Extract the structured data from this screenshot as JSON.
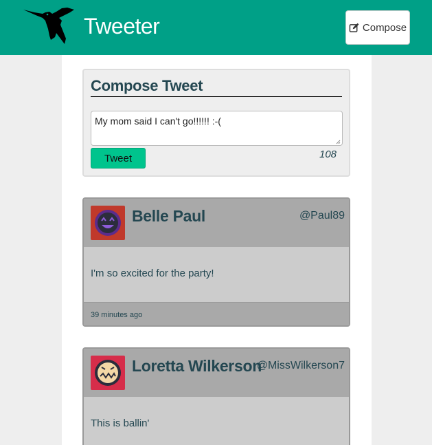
{
  "navbar": {
    "brand": "Tweeter",
    "compose_label": "Compose",
    "logo_icon": "hummingbird-icon",
    "compose_icon": "edit-icon",
    "background": "#00a087"
  },
  "new_tweet": {
    "heading": "Compose Tweet",
    "text_value": "My mom said I can't go!!!!!! :-(",
    "button_label": "Tweet",
    "char_counter": "108",
    "button_color": "#00c48d"
  },
  "tweets": [
    {
      "name": "Belle Paul",
      "handle": "@Paul89",
      "content": "I'm so excited for the party!",
      "timestamp": "39 minutes ago",
      "avatar_icon": "smiling-face-avatar-icon",
      "avatar_bg": "#c0392b"
    },
    {
      "name": "Loretta Wilkerson",
      "handle": "@MissWilkerson7",
      "content": "This is ballin'",
      "avatar_icon": "grimacing-face-avatar-icon",
      "avatar_bg": "#d62d4a"
    }
  ]
}
